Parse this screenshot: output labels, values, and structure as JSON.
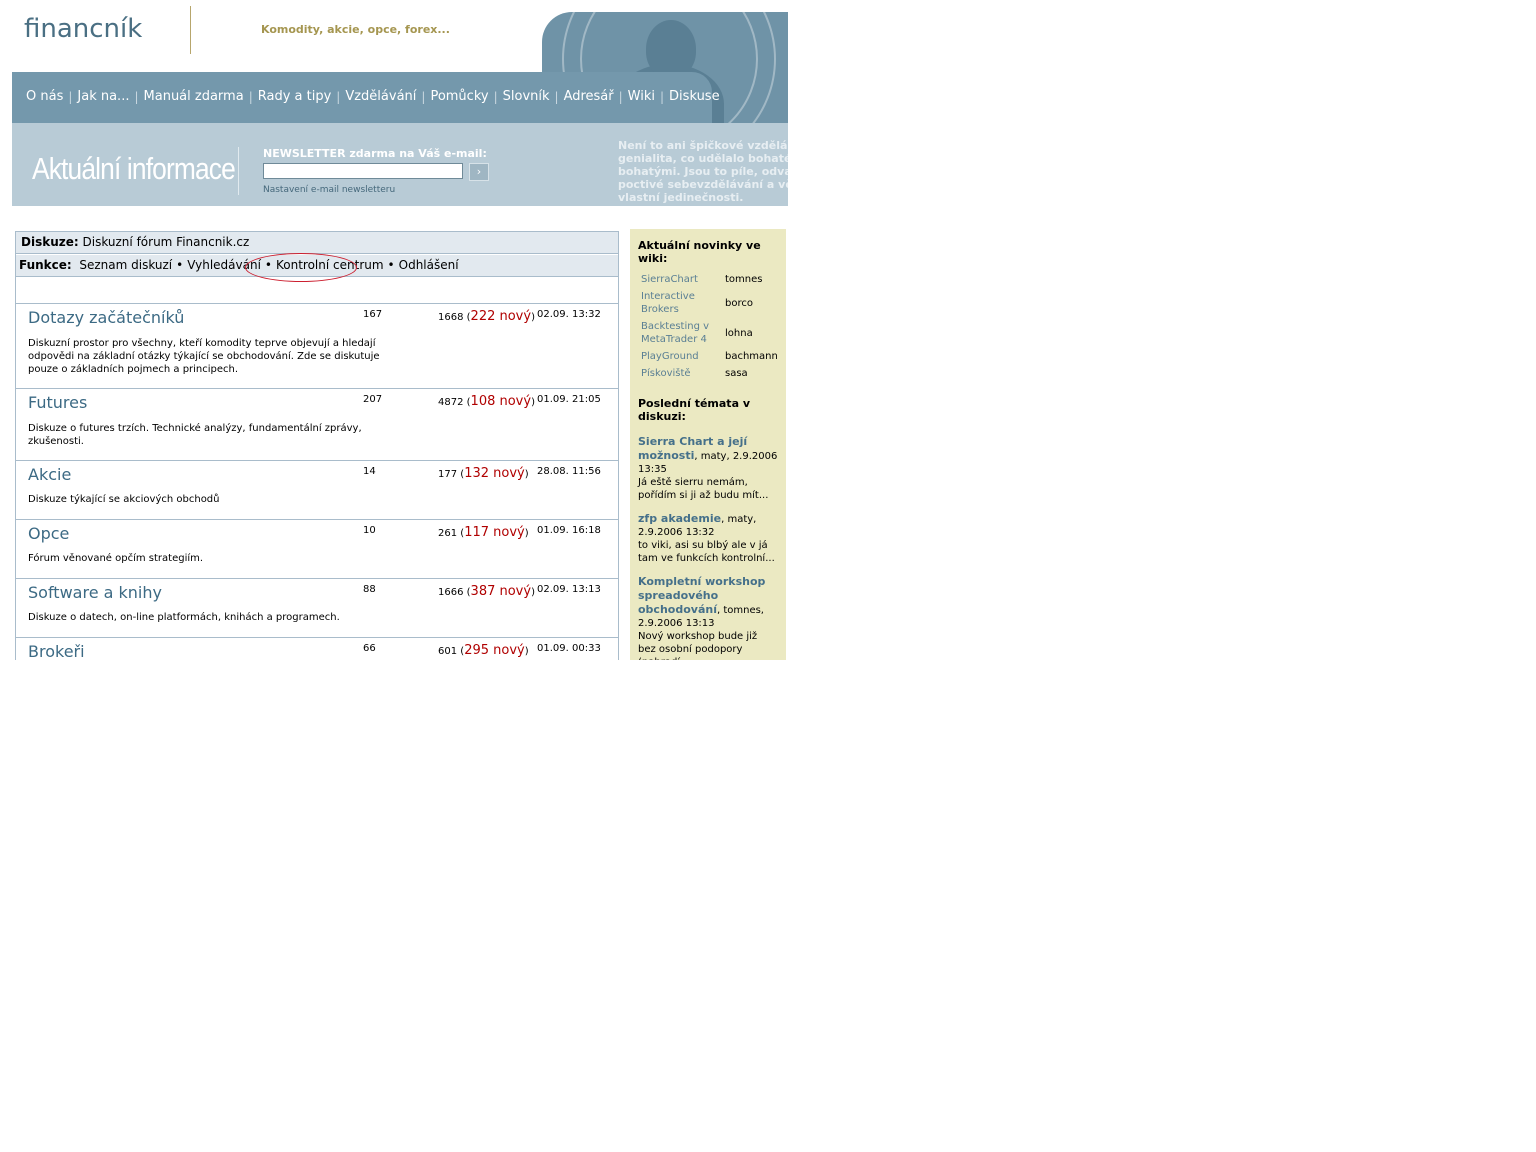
{
  "header": {
    "logo_text": "financník",
    "slogan": "Komodity, akcie, opce, forex...",
    "nav": [
      "O nás",
      "Jak na...",
      "Manuál zdarma",
      "Rady a tipy",
      "Vzdělávání",
      "Pomůcky",
      "Slovník",
      "Adresář",
      "Wiki",
      "Diskuse"
    ],
    "section_title": "Aktuální informace",
    "newsletter_label": "NEWSLETTER zdarma na Váš e-mail:",
    "newsletter_value": "",
    "newsletter_submit": "›",
    "newsletter_settings": "Nastavení e-mail newsletteru",
    "quote_lines": [
      "Není to ani špičkové vzdělání, a",
      "genialita, co udělalo bohaté",
      "bohatými. Jsou to píle, odvaha",
      "poctivé sebevzdělávání a vědo",
      "vlastní jedinečnosti."
    ]
  },
  "forum": {
    "crumb_label": "Diskuze:",
    "crumb_value": "Diskuzní fórum Financnik.cz",
    "funcs_label": "Funkce:",
    "funcs": [
      "Seznam diskuzí",
      "Vyhledávání",
      "Kontrolní centrum",
      "Odhlášení"
    ],
    "rows": [
      {
        "title": "Dotazy začátečníků",
        "desc": "Diskuzní prostor pro všechny, kteří komodity teprve objevují a hledají odpovědi na základní otázky týkající se obchodování. Zde se diskutuje pouze o základních pojmech a principech.",
        "topics": "167",
        "posts": "1668",
        "new": "222 nový",
        "date": "02.09. 13:32"
      },
      {
        "title": "Futures",
        "desc": "Diskuze o futures trzích. Technické analýzy, fundamentální zprávy, zkušenosti.",
        "topics": "207",
        "posts": "4872",
        "new": "108 nový",
        "date": "01.09. 21:05"
      },
      {
        "title": "Akcie",
        "desc": "Diskuze týkající se akciových obchodů",
        "topics": "14",
        "posts": "177",
        "new": "132 nový",
        "date": "28.08. 11:56"
      },
      {
        "title": "Opce",
        "desc": "Fórum věnované opčím strategiím.",
        "topics": "10",
        "posts": "261",
        "new": "117 nový",
        "date": "01.09. 16:18"
      },
      {
        "title": "Software a knihy",
        "desc": "Diskuze o datech, on-line platformách, knihách a programech.",
        "topics": "88",
        "posts": "1666",
        "new": "387 nový",
        "date": "02.09. 13:13"
      },
      {
        "title": "Brokeři",
        "desc": "",
        "topics": "66",
        "posts": "601",
        "new": "295 nový",
        "date": "01.09. 00:33"
      }
    ]
  },
  "sidebar": {
    "wiki_heading": "Aktuální novinky ve wiki:",
    "wiki": [
      {
        "page": "SierraChart",
        "user": "tomnes"
      },
      {
        "page": "Interactive Brokers",
        "user": "borco"
      },
      {
        "page": "Backtesting v MetaTrader 4",
        "user": "lohna"
      },
      {
        "page": "PlayGround",
        "user": "bachmann"
      },
      {
        "page": "Pískoviště",
        "user": "sasa"
      }
    ],
    "topics_heading": "Poslední témata v diskuzi:",
    "topics": [
      {
        "title": "Sierra Chart a její možnosti",
        "meta": ", maty, 2.9.2006 13:35",
        "excerpt": "Já eště sierru nemám, pořídím si ji až budu mít..."
      },
      {
        "title": "zfp akademie",
        "meta": ", maty, 2.9.2006 13:32",
        "excerpt": "to viki, asi su blbý ale v já tam ve funkcích kontrolní..."
      },
      {
        "title": "Kompletní workshop spreadového obchodování",
        "meta": ", tomnes, 2.9.2006 13:13",
        "excerpt": "Nový workshop bude již bez osobní podopory (nahradí..."
      }
    ]
  }
}
